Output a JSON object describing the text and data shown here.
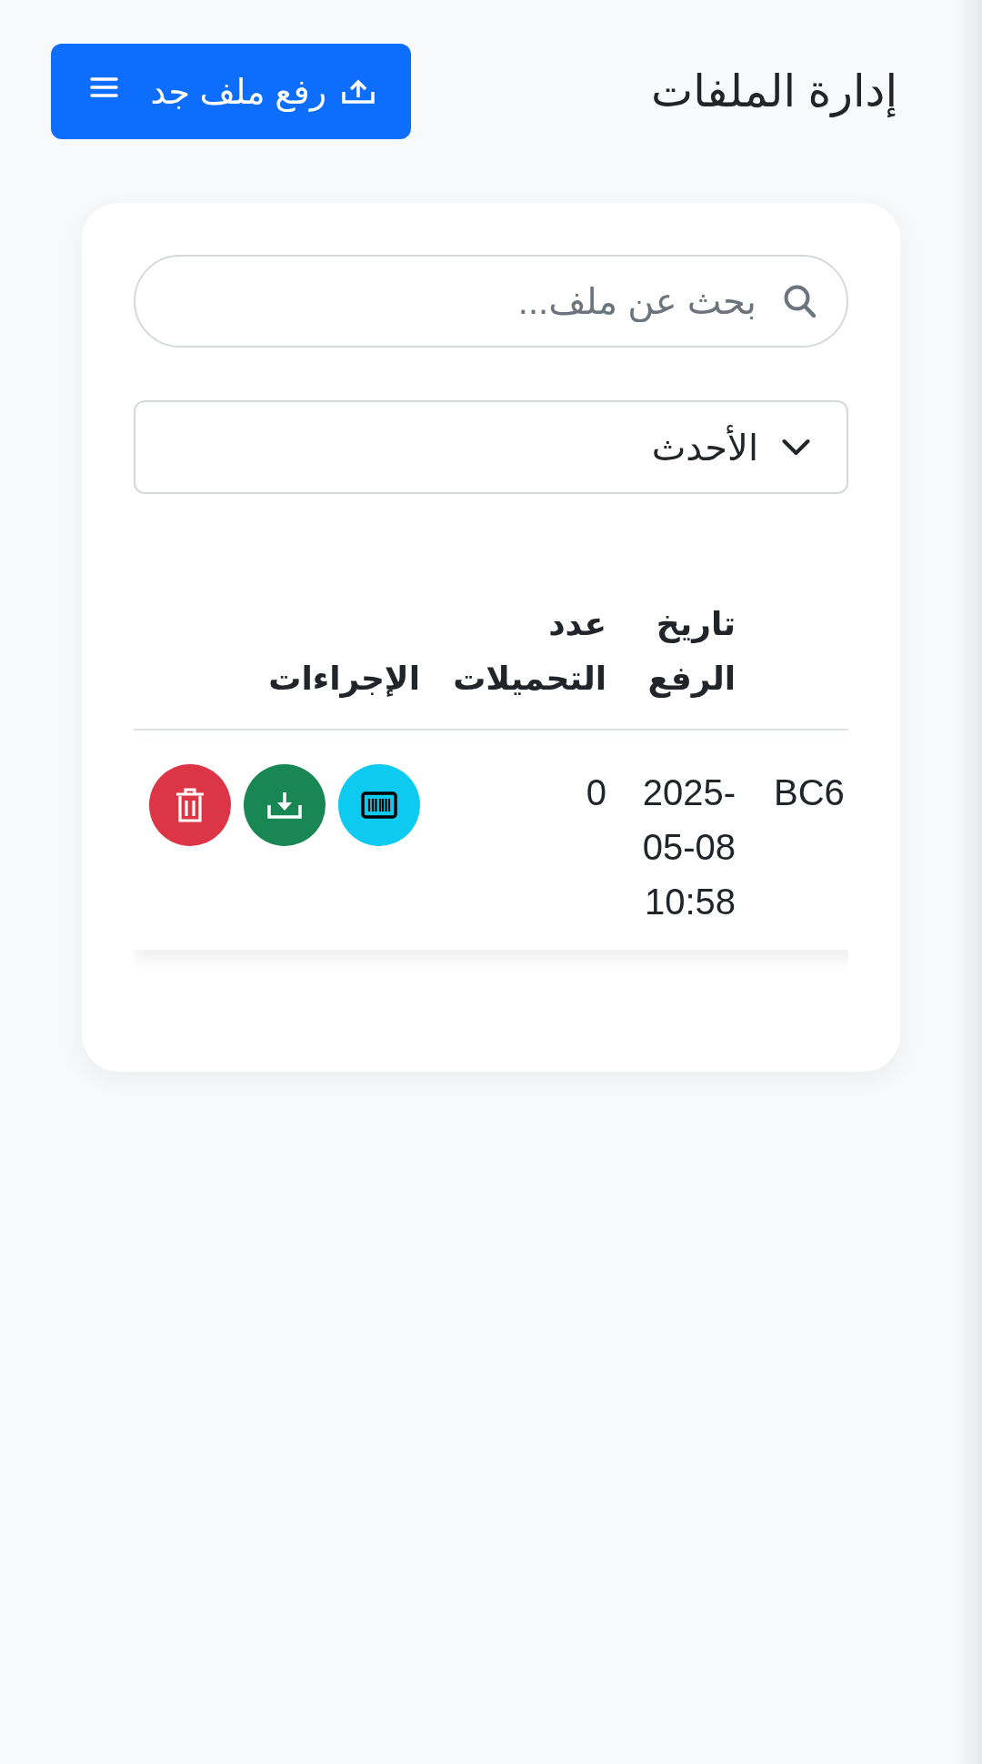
{
  "header": {
    "title": "إدارة الملفات",
    "upload_button": {
      "label": "رفع ملف جد"
    }
  },
  "search": {
    "placeholder": "بحث عن ملف..."
  },
  "sort_select": {
    "value": "الأحدث"
  },
  "table": {
    "columns": [
      "تاريخ الرفع",
      "عدد التحميلات",
      "الإجراءات"
    ],
    "rows": [
      {
        "column_1": "BC6",
        "upload_date": "2025-05-08 10:58",
        "downloads": "0"
      }
    ]
  }
}
